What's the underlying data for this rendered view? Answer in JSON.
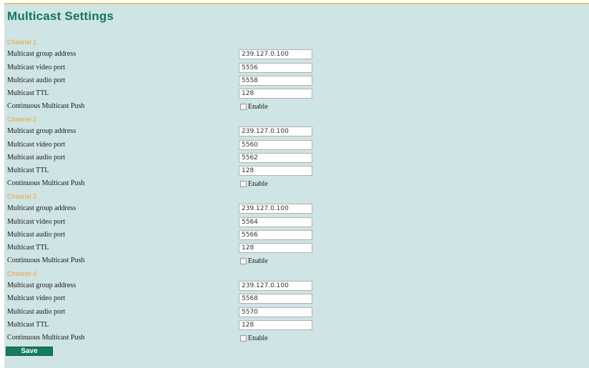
{
  "page": {
    "title": "Multicast Settings"
  },
  "labels": {
    "group_address": "Multicast group address",
    "video_port": "Multicast video port",
    "audio_port": "Multicast audio port",
    "ttl": "Multicast TTL",
    "continuous_push": "Continuous Multicast Push",
    "enable": "Enable"
  },
  "channels": [
    {
      "heading": "Channel 1",
      "group_address": "239.127.0.100",
      "video_port": "5556",
      "audio_port": "5558",
      "ttl": "128",
      "continuous_push_enabled": false
    },
    {
      "heading": "Channel 2",
      "group_address": "239.127.0.100",
      "video_port": "5560",
      "audio_port": "5562",
      "ttl": "128",
      "continuous_push_enabled": false
    },
    {
      "heading": "Channel 3",
      "group_address": "239.127.0.100",
      "video_port": "5564",
      "audio_port": "5566",
      "ttl": "128",
      "continuous_push_enabled": false
    },
    {
      "heading": "Channel 4",
      "group_address": "239.127.0.100",
      "video_port": "5568",
      "audio_port": "5570",
      "ttl": "128",
      "continuous_push_enabled": false
    }
  ],
  "actions": {
    "save_label": "Save"
  },
  "colors": {
    "background": "#cfe4e4",
    "title": "#0f7a5a",
    "channel_heading": "#f0a23a",
    "save_button": "#147c5c",
    "top_border": "#e8c56a"
  }
}
